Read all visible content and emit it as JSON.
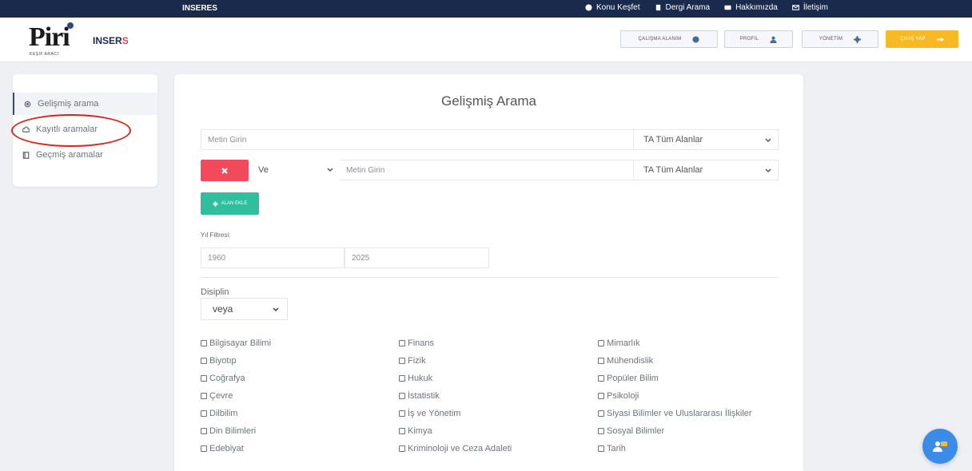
{
  "topbar": {
    "brand": "INSERES",
    "nav": [
      {
        "label": "Konu Keşfet",
        "icon": "globe-icon"
      },
      {
        "label": "Dergi Arama",
        "icon": "book-icon"
      },
      {
        "label": "Hakkımızda",
        "icon": "id-card-icon"
      },
      {
        "label": "İletişim",
        "icon": "envelope-icon"
      }
    ]
  },
  "header": {
    "logo_text": "Piri",
    "logo_subtitle": "KEŞİF ARACI",
    "inser_logo": "INSER",
    "inser_logo_s": "S",
    "buttons": {
      "workspace": "ÇALIŞMA ALANIM",
      "profile": "PROFİL",
      "admin": "YÖNETİM",
      "logout": "ÇIKIŞ YAP"
    }
  },
  "sidebar": {
    "items": [
      {
        "label": "Gelişmiş arama",
        "icon": "gear-dot-icon",
        "active": true
      },
      {
        "label": "Kayıtlı aramalar",
        "icon": "cloud-icon",
        "active": false
      },
      {
        "label": "Geçmiş aramalar",
        "icon": "document-icon",
        "active": false
      }
    ]
  },
  "main": {
    "title": "Gelişmiş Arama",
    "row1": {
      "placeholder": "Metin Girin",
      "field_select": "TA Tüm Alanlar"
    },
    "row2": {
      "operator": "Ve",
      "placeholder": "Metin Girin",
      "field_select": "TA Tüm Alanlar"
    },
    "add_field_label": "ALAN EKLE",
    "year_filter_label": "Yıl Filtresi:",
    "year_from": "1960",
    "year_to": "2025",
    "discipline_label": "Disiplin",
    "discipline_operator": "veya",
    "disciplines": [
      [
        "Bilgisayar Bilimi",
        "Finans",
        "Mimarlık"
      ],
      [
        "Biyotıp",
        "Fizik",
        "Mühendislik"
      ],
      [
        "Coğrafya",
        "Hukuk",
        "Popüler Bilim"
      ],
      [
        "Çevre",
        "İstatistik",
        "Psikoloji"
      ],
      [
        "Dilbilim",
        "İş ve Yönetim",
        "Siyasi Bilimler ve Uluslararası İlişkiler"
      ],
      [
        "Din Bilimleri",
        "Kimya",
        "Sosyal Bilimler"
      ],
      [
        "Edebiyat",
        "Kriminoloji ve Ceza Adaleti",
        "Tarih"
      ]
    ]
  },
  "colors": {
    "topbar": "#1a2a4d",
    "logout": "#f7b924",
    "delete": "#f04a5b",
    "add": "#2fbf9e",
    "fab": "#3b8be8",
    "annotation": "#e0201a"
  }
}
